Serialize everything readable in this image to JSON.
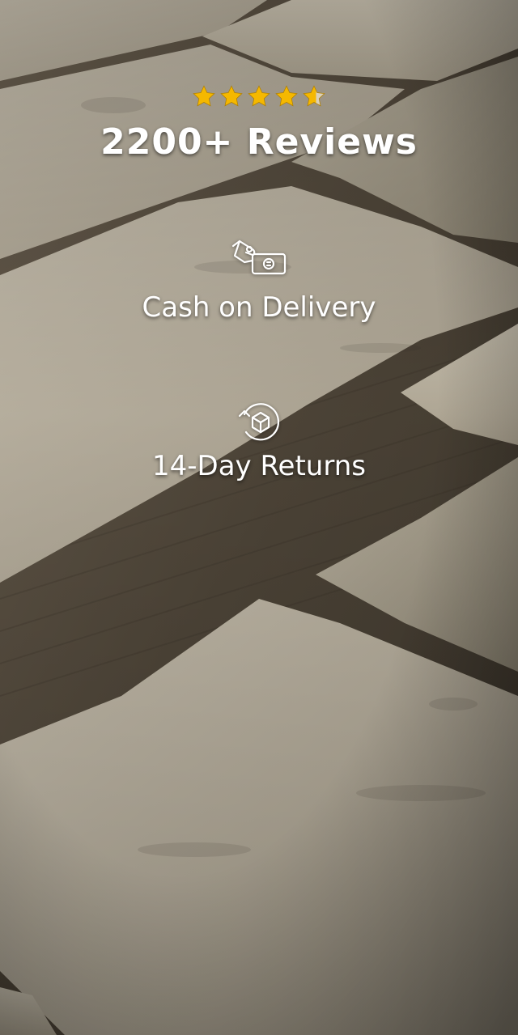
{
  "rating": {
    "stars": 4.5,
    "star_color": "#f5b800",
    "reviews_label": "2200+ Reviews"
  },
  "features": [
    {
      "icon": "cash-hand-icon",
      "label": "Cash on Delivery"
    },
    {
      "icon": "return-box-icon",
      "label": "14-Day Returns"
    }
  ]
}
